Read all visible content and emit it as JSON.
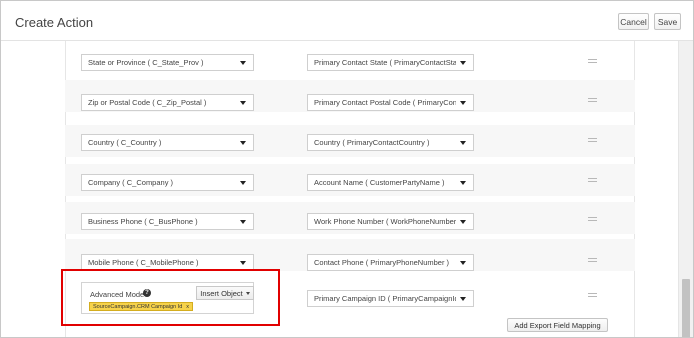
{
  "header": {
    "title": "Create Action",
    "cancel_label": "Cancel",
    "save_label": "Save"
  },
  "mappings": [
    {
      "source": "State or Province ( C_State_Prov )",
      "target": "Primary Contact State ( PrimaryContactState )"
    },
    {
      "source": "Zip or Postal Code ( C_Zip_Postal )",
      "target": "Primary Contact Postal Code ( PrimaryContactP"
    },
    {
      "source": "Country ( C_Country )",
      "target": "Country ( PrimaryContactCountry )"
    },
    {
      "source": "Company ( C_Company )",
      "target": "Account Name ( CustomerPartyName )"
    },
    {
      "source": "Business Phone ( C_BusPhone )",
      "target": "Work Phone Number ( WorkPhoneNumber )"
    },
    {
      "source": "Mobile Phone ( C_MobilePhone )",
      "target": "Contact Phone ( PrimaryPhoneNumber )"
    }
  ],
  "advanced": {
    "label": "Advanced Mode",
    "help_glyph": "?",
    "insert_label": "Insert Object",
    "tag_text": "SourceCampaign.CRM Campaign Id",
    "tag_remove": "x",
    "target": "Primary Campaign ID ( PrimaryCampaignId )"
  },
  "footer": {
    "add_label": "Add Export Field Mapping"
  },
  "colors": {
    "highlight": "#e10000",
    "tag": "#f6d24a"
  }
}
